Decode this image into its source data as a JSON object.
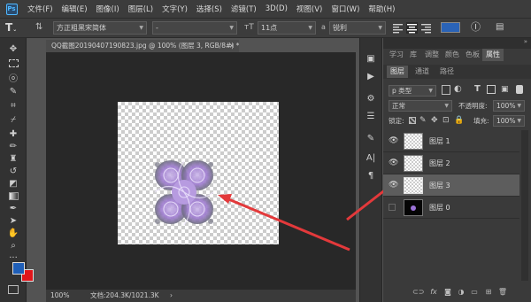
{
  "menu": {
    "logo": "Ps",
    "items": [
      "文件(F)",
      "编辑(E)",
      "图像(I)",
      "图层(L)",
      "文字(Y)",
      "选择(S)",
      "滤镜(T)",
      "3D(D)",
      "视图(V)",
      "窗口(W)",
      "帮助(H)"
    ]
  },
  "options": {
    "font_family": "方正粗黑宋简体",
    "font_style": "-",
    "font_size": "11点",
    "antialias": "锐利",
    "text_color": "#2a63b7"
  },
  "document": {
    "tab_title": "QQ截图20190407190823.jpg @ 100% (图层 3, RGB/8#) *",
    "zoom": "100%",
    "doc_size": "文档:204.3K/1021.3K"
  },
  "colors": {
    "foreground": "#1f5fb8",
    "background": "#e0151a",
    "arrow": "#e3393b"
  },
  "panel_tabs": {
    "top": [
      "学习",
      "库",
      "调整",
      "颜色",
      "色板",
      "属性"
    ],
    "active_top": "属性",
    "layer_tabs": [
      "图层",
      "通道",
      "路径"
    ],
    "active_layer_tab": "图层"
  },
  "layers_panel": {
    "filter_kind": "p 类型",
    "blend_mode": "正常",
    "opacity_label": "不透明度:",
    "opacity_value": "100%",
    "lock_label": "锁定:",
    "fill_label": "填充:",
    "fill_value": "100%",
    "layers": [
      {
        "name": "图层 1",
        "visible": true,
        "selected": false
      },
      {
        "name": "图层 2",
        "visible": true,
        "selected": false
      },
      {
        "name": "图层 3",
        "visible": true,
        "selected": true
      },
      {
        "name": "图层 0",
        "visible": false,
        "selected": false
      }
    ]
  }
}
